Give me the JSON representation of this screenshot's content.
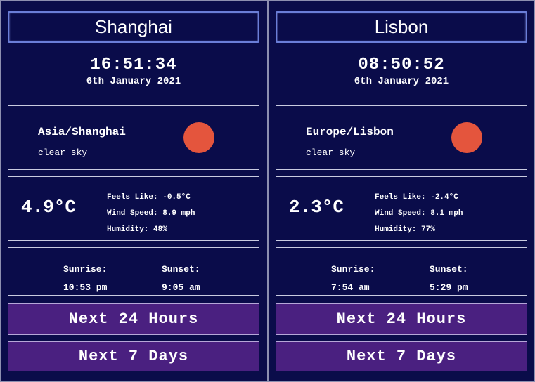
{
  "cities": [
    {
      "name": "Shanghai",
      "time": "16:51:34",
      "date": "6th January 2021",
      "timezone": "Asia/Shanghai",
      "description": "clear sky",
      "icon": "sun-icon",
      "temperature": "4.9°C",
      "feels_like": "Feels Like: -0.5°C",
      "wind_speed": "Wind Speed: 8.9 mph",
      "humidity": "Humidity: 48%",
      "sunrise_label": "Sunrise:",
      "sunrise": "10:53 pm",
      "sunset_label": "Sunset:",
      "sunset": "9:05 am",
      "next_24_label": "Next 24 Hours",
      "next_7_label": "Next 7 Days"
    },
    {
      "name": "Lisbon",
      "time": "08:50:52",
      "date": "6th January 2021",
      "timezone": "Europe/Lisbon",
      "description": "clear sky",
      "icon": "sun-icon",
      "temperature": "2.3°C",
      "feels_like": "Feels Like: -2.4°C",
      "wind_speed": "Wind Speed: 8.1 mph",
      "humidity": "Humidity: 77%",
      "sunrise_label": "Sunrise:",
      "sunrise": "7:54 am",
      "sunset_label": "Sunset:",
      "sunset": "5:29 pm",
      "next_24_label": "Next 24 Hours",
      "next_7_label": "Next 7 Days"
    }
  ],
  "colors": {
    "background": "#0a0c4a",
    "sun": "#e4553d",
    "button": "#4a2080"
  }
}
